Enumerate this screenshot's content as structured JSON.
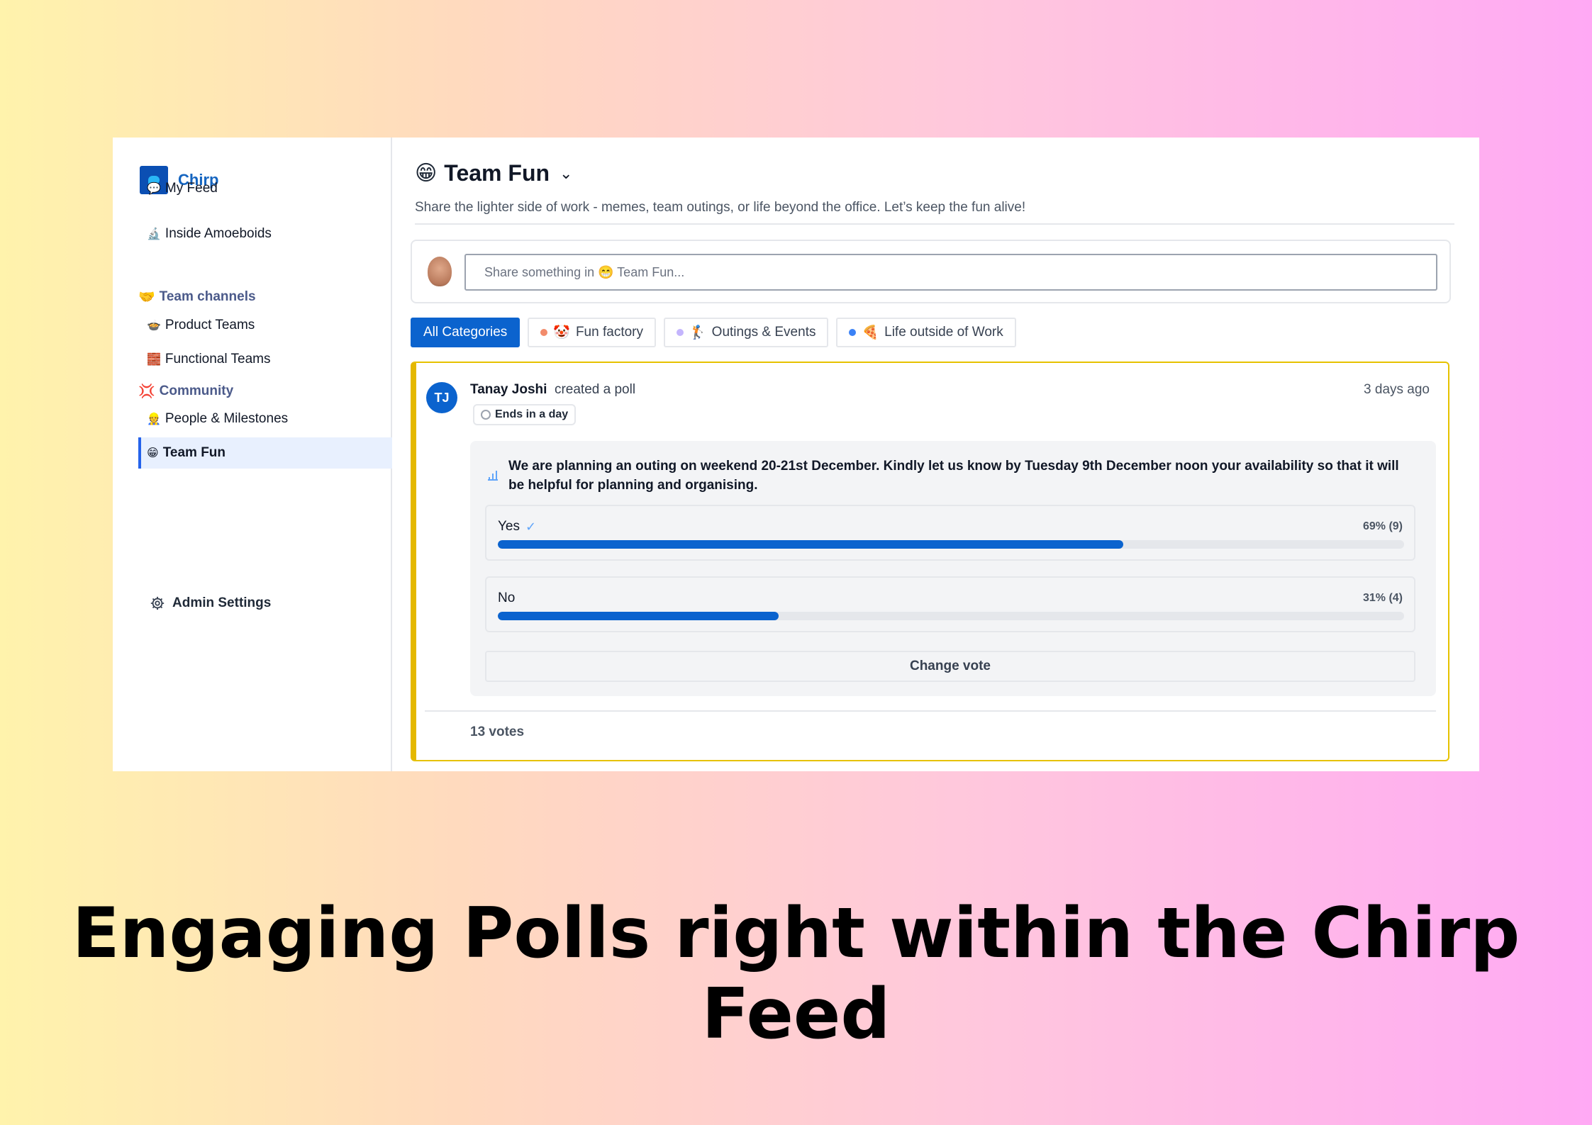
{
  "brand": {
    "name": "Chirp"
  },
  "sidebar": {
    "items": [
      {
        "emoji": "💬",
        "label": "My Feed"
      },
      {
        "emoji": "🔬",
        "label": "Inside Amoeboids"
      }
    ],
    "sections": [
      {
        "emoji": "🤝",
        "label": "Team channels"
      },
      {
        "emoji": "💢",
        "label": "Community"
      }
    ],
    "team_channels": [
      {
        "emoji": "🍲",
        "label": "Product Teams"
      },
      {
        "emoji": "🧱",
        "label": "Functional Teams"
      }
    ],
    "community": [
      {
        "emoji": "👷",
        "label": "People & Milestones"
      },
      {
        "emoji": "😁",
        "label": "Team Fun"
      }
    ],
    "admin_label": "Admin Settings"
  },
  "main": {
    "title_emoji": "😁",
    "title": "Team Fun",
    "subtitle": "Share the lighter side of work - memes, team outings, or life beyond the office. Let’s keep the fun alive!",
    "composer_placeholder": "Share something in 😁 Team Fun...",
    "categories": [
      {
        "label": "All Categories",
        "active": true
      },
      {
        "emoji": "🤡",
        "label": "Fun factory",
        "dot_color": "#f28b6b"
      },
      {
        "emoji": "🏌️",
        "label": "Outings & Events",
        "dot_color": "#c4b5fd"
      },
      {
        "emoji": "🍕",
        "label": "Life outside of Work",
        "dot_color": "#3b82f6"
      }
    ]
  },
  "post": {
    "author_initials": "TJ",
    "author": "Tanay Joshi",
    "action": "created a poll",
    "time": "3 days ago",
    "ends_label": "Ends in a day",
    "question": "We are planning an outing on weekend 20-21st December. Kindly let us know by Tuesday 9th December noon your availability so that it will be helpful for planning and organising.",
    "options": [
      {
        "label": "Yes",
        "percent_text": "69% (9)",
        "fraction": 0.69,
        "selected": true
      },
      {
        "label": "No",
        "percent_text": "31% (4)",
        "fraction": 0.31,
        "selected": false
      }
    ],
    "change_vote_label": "Change vote",
    "votes_label": "13 votes"
  },
  "headline": "Engaging Polls right within the Chirp Feed",
  "colors": {
    "accent": "#0b63ce",
    "post_border": "#e4b800"
  }
}
